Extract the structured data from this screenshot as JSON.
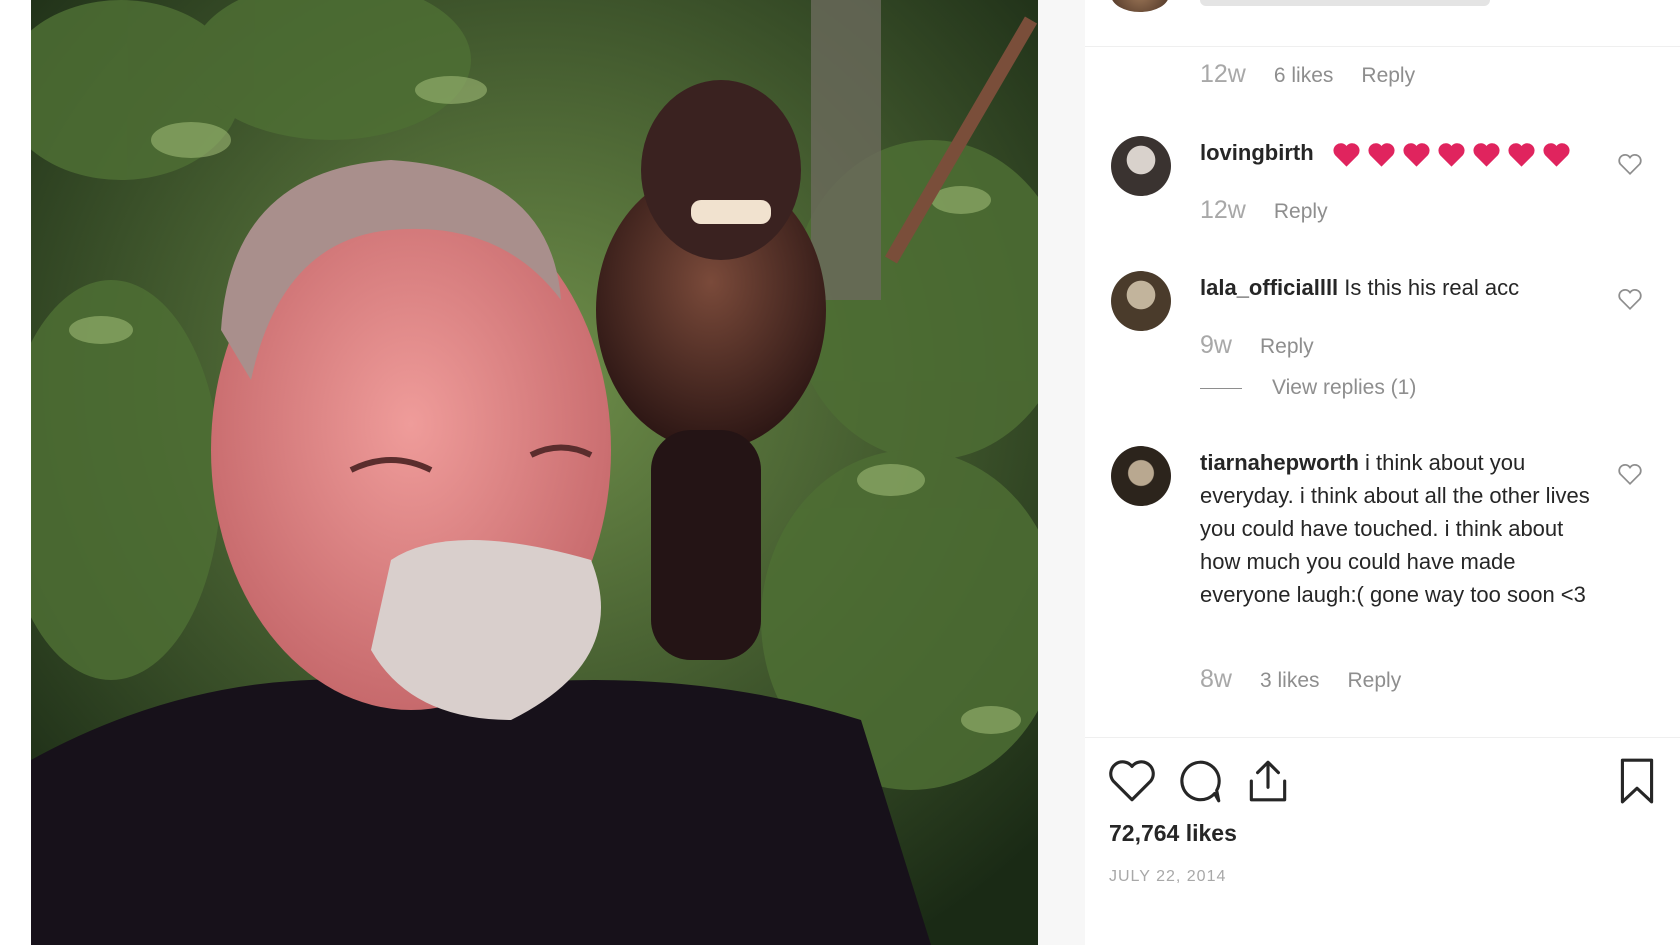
{
  "post": {
    "image_alt": "Smiling gray-haired man in a dark t-shirt with a capuchin monkey perched on his shoulder in front of green foliage",
    "likes": "72,764 likes",
    "date": "JULY 22, 2014"
  },
  "previous_comment": {
    "age": "12w",
    "likes": "6 likes",
    "reply": "Reply"
  },
  "comments": [
    {
      "username": "lovingbirth",
      "text": "",
      "emoji": [
        "red-heart",
        "red-heart",
        "red-heart",
        "red-heart",
        "red-heart",
        "red-heart",
        "red-heart"
      ],
      "age": "12w",
      "reply": "Reply"
    },
    {
      "username": "lala_officiallll",
      "text": "Is this his real acc",
      "age": "9w",
      "reply": "Reply",
      "view_replies": "View replies (1)"
    },
    {
      "username": "tiarnahepworth",
      "text": "i think about you everyday. i think about all the other lives you could have touched. i think about how much you could have made everyone laugh:( gone way too soon <3",
      "age": "8w",
      "likes": "3 likes",
      "reply": "Reply"
    }
  ],
  "icons": {
    "like": "heart-outline-icon",
    "comment": "speech-bubble-icon",
    "share": "share-icon",
    "save": "bookmark-icon",
    "comment_like": "small-heart-icon"
  },
  "colors": {
    "heart_emoji": "#e0245e",
    "muted_text": "#8e8e8e",
    "text": "#262626"
  }
}
